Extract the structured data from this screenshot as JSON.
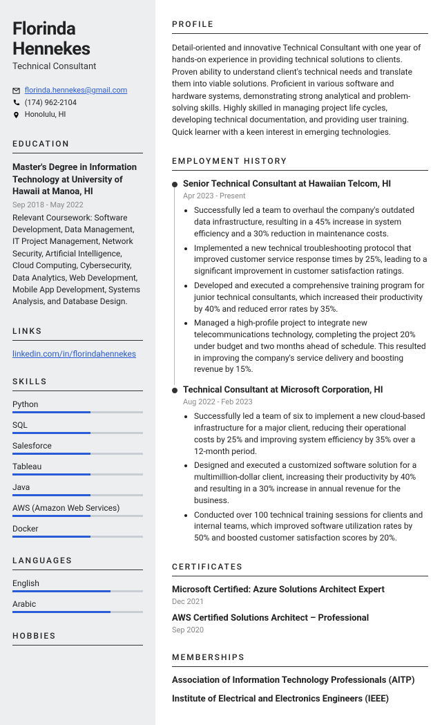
{
  "name_first": "Florinda",
  "name_last": "Hennekes",
  "title": "Technical Consultant",
  "contact": {
    "email": "florinda.hennekes@gmail.com",
    "phone": "(174) 962-2104",
    "location": "Honolulu, HI"
  },
  "headings": {
    "education": "EDUCATION",
    "links": "LINKS",
    "skills": "SKILLS",
    "languages": "LANGUAGES",
    "hobbies": "HOBBIES",
    "profile": "PROFILE",
    "employment": "EMPLOYMENT HISTORY",
    "certificates": "CERTIFICATES",
    "memberships": "MEMBERSHIPS"
  },
  "education": {
    "degree": "Master's Degree in Information Technology at University of Hawaii at Manoa, HI",
    "dates": "Sep 2018 - May 2022",
    "desc": "Relevant Coursework: Software Development, Data Management, IT Project Management, Network Security, Artificial Intelligence, Cloud Computing, Cybersecurity, Data Analytics, Web Development, Mobile App Development, Systems Analysis, and Database Design."
  },
  "links": {
    "linkedin": "linkedin.com/in/florindahennekes"
  },
  "skills": [
    {
      "label": "Python",
      "pct": 60
    },
    {
      "label": "SQL",
      "pct": 60
    },
    {
      "label": "Salesforce",
      "pct": 60
    },
    {
      "label": "Tableau",
      "pct": 60
    },
    {
      "label": "Java",
      "pct": 60
    },
    {
      "label": "AWS (Amazon Web Services)",
      "pct": 60
    },
    {
      "label": "Docker",
      "pct": 60
    }
  ],
  "languages": [
    {
      "label": "English",
      "pct": 75
    },
    {
      "label": "Arabic",
      "pct": 75
    }
  ],
  "profile": "Detail-oriented and innovative Technical Consultant with one year of hands-on experience in providing technical solutions to clients. Proven ability to understand client's technical needs and translate them into viable solutions. Proficient in various software and hardware systems, demonstrating strong analytical and problem-solving skills. Highly skilled in managing project life cycles, developing technical documentation, and providing user training. Quick learner with a keen interest in emerging technologies.",
  "jobs": [
    {
      "title": "Senior Technical Consultant at Hawaiian Telcom, HI",
      "dates": "Apr 2023 - Present",
      "bullets": [
        "Successfully led a team to overhaul the company's outdated data infrastructure, resulting in a 45% increase in system efficiency and a 30% reduction in maintenance costs.",
        "Implemented a new technical troubleshooting protocol that improved customer service response times by 25%, leading to a significant improvement in customer satisfaction ratings.",
        "Developed and executed a comprehensive training program for junior technical consultants, which increased their productivity by 40% and reduced error rates by 35%.",
        "Managed a high-profile project to integrate new telecommunications technology, completing the project 20% under budget and two months ahead of schedule. This resulted in improving the company's service delivery and boosting revenue by 15%."
      ]
    },
    {
      "title": "Technical Consultant at Microsoft Corporation, HI",
      "dates": "Aug 2022 - Feb 2023",
      "bullets": [
        "Successfully led a team of six to implement a new cloud-based infrastructure for a major client, reducing their operational costs by 25% and improving system efficiency by 35% over a 12-month period.",
        "Designed and executed a customized software solution for a multimillion-dollar client, increasing their productivity by 40% and resulting in a 30% increase in annual revenue for the business.",
        "Conducted over 100 technical training sessions for clients and internal teams, which improved software utilization rates by 50% and boosted customer satisfaction scores by 20%."
      ]
    }
  ],
  "certificates": [
    {
      "title": "Microsoft Certified: Azure Solutions Architect Expert",
      "date": "Dec 2021"
    },
    {
      "title": "AWS Certified Solutions Architect – Professional",
      "date": "Sep 2020"
    }
  ],
  "memberships": [
    "Association of Information Technology Professionals (AITP)",
    "Institute of Electrical and Electronics Engineers (IEEE)"
  ]
}
